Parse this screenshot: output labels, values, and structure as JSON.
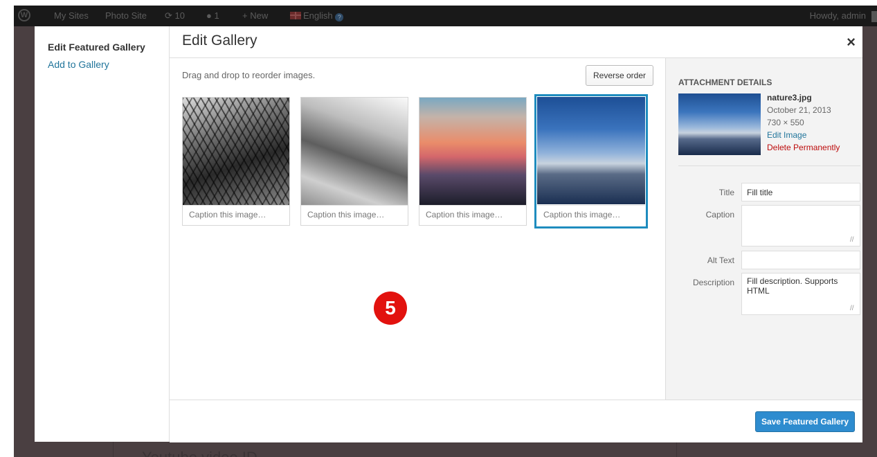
{
  "adminbar": {
    "items": [
      {
        "label": "My Sites"
      },
      {
        "label": "Photo Site"
      },
      {
        "label": "10"
      },
      {
        "label": "1"
      },
      {
        "label": "New"
      },
      {
        "label": "English"
      }
    ],
    "greeting": "Howdy, admin",
    "icons": [
      "wordpress-icon",
      "update-icon",
      "comment-icon",
      "plus-icon",
      "uk-flag-icon",
      "help-icon"
    ]
  },
  "sidebar": {
    "title": "Edit Featured Gallery",
    "link": "Add to Gallery"
  },
  "modal": {
    "title": "Edit Gallery",
    "close": "×",
    "hint": "Drag and drop to reorder images.",
    "reverse_label": "Reverse order",
    "images": [
      {
        "caption_placeholder": "Caption this image…"
      },
      {
        "caption_placeholder": "Caption this image…"
      },
      {
        "caption_placeholder": "Caption this image…"
      },
      {
        "caption_placeholder": "Caption this image…"
      }
    ],
    "badge": "5"
  },
  "details": {
    "heading": "ATTACHMENT DETAILS",
    "filename": "nature3.jpg",
    "date": "October 21, 2013",
    "dimensions": "730 × 550",
    "edit_link": "Edit Image",
    "delete_link": "Delete Permanently",
    "fields": {
      "title_label": "Title",
      "title_value": "Fill title",
      "caption_label": "Caption",
      "caption_value": "",
      "alt_label": "Alt Text",
      "alt_value": "",
      "description_label": "Description",
      "description_value": "Fill description. Supports HTML"
    }
  },
  "footer": {
    "save_label": "Save Featured Gallery"
  },
  "background": {
    "underlying_text": "Youtube video ID"
  },
  "colors": {
    "accent": "#1e8cbe",
    "link": "#21759b",
    "danger": "#bc0b0b",
    "primary_button": "#2e8ccf",
    "badge": "#e2120e"
  }
}
